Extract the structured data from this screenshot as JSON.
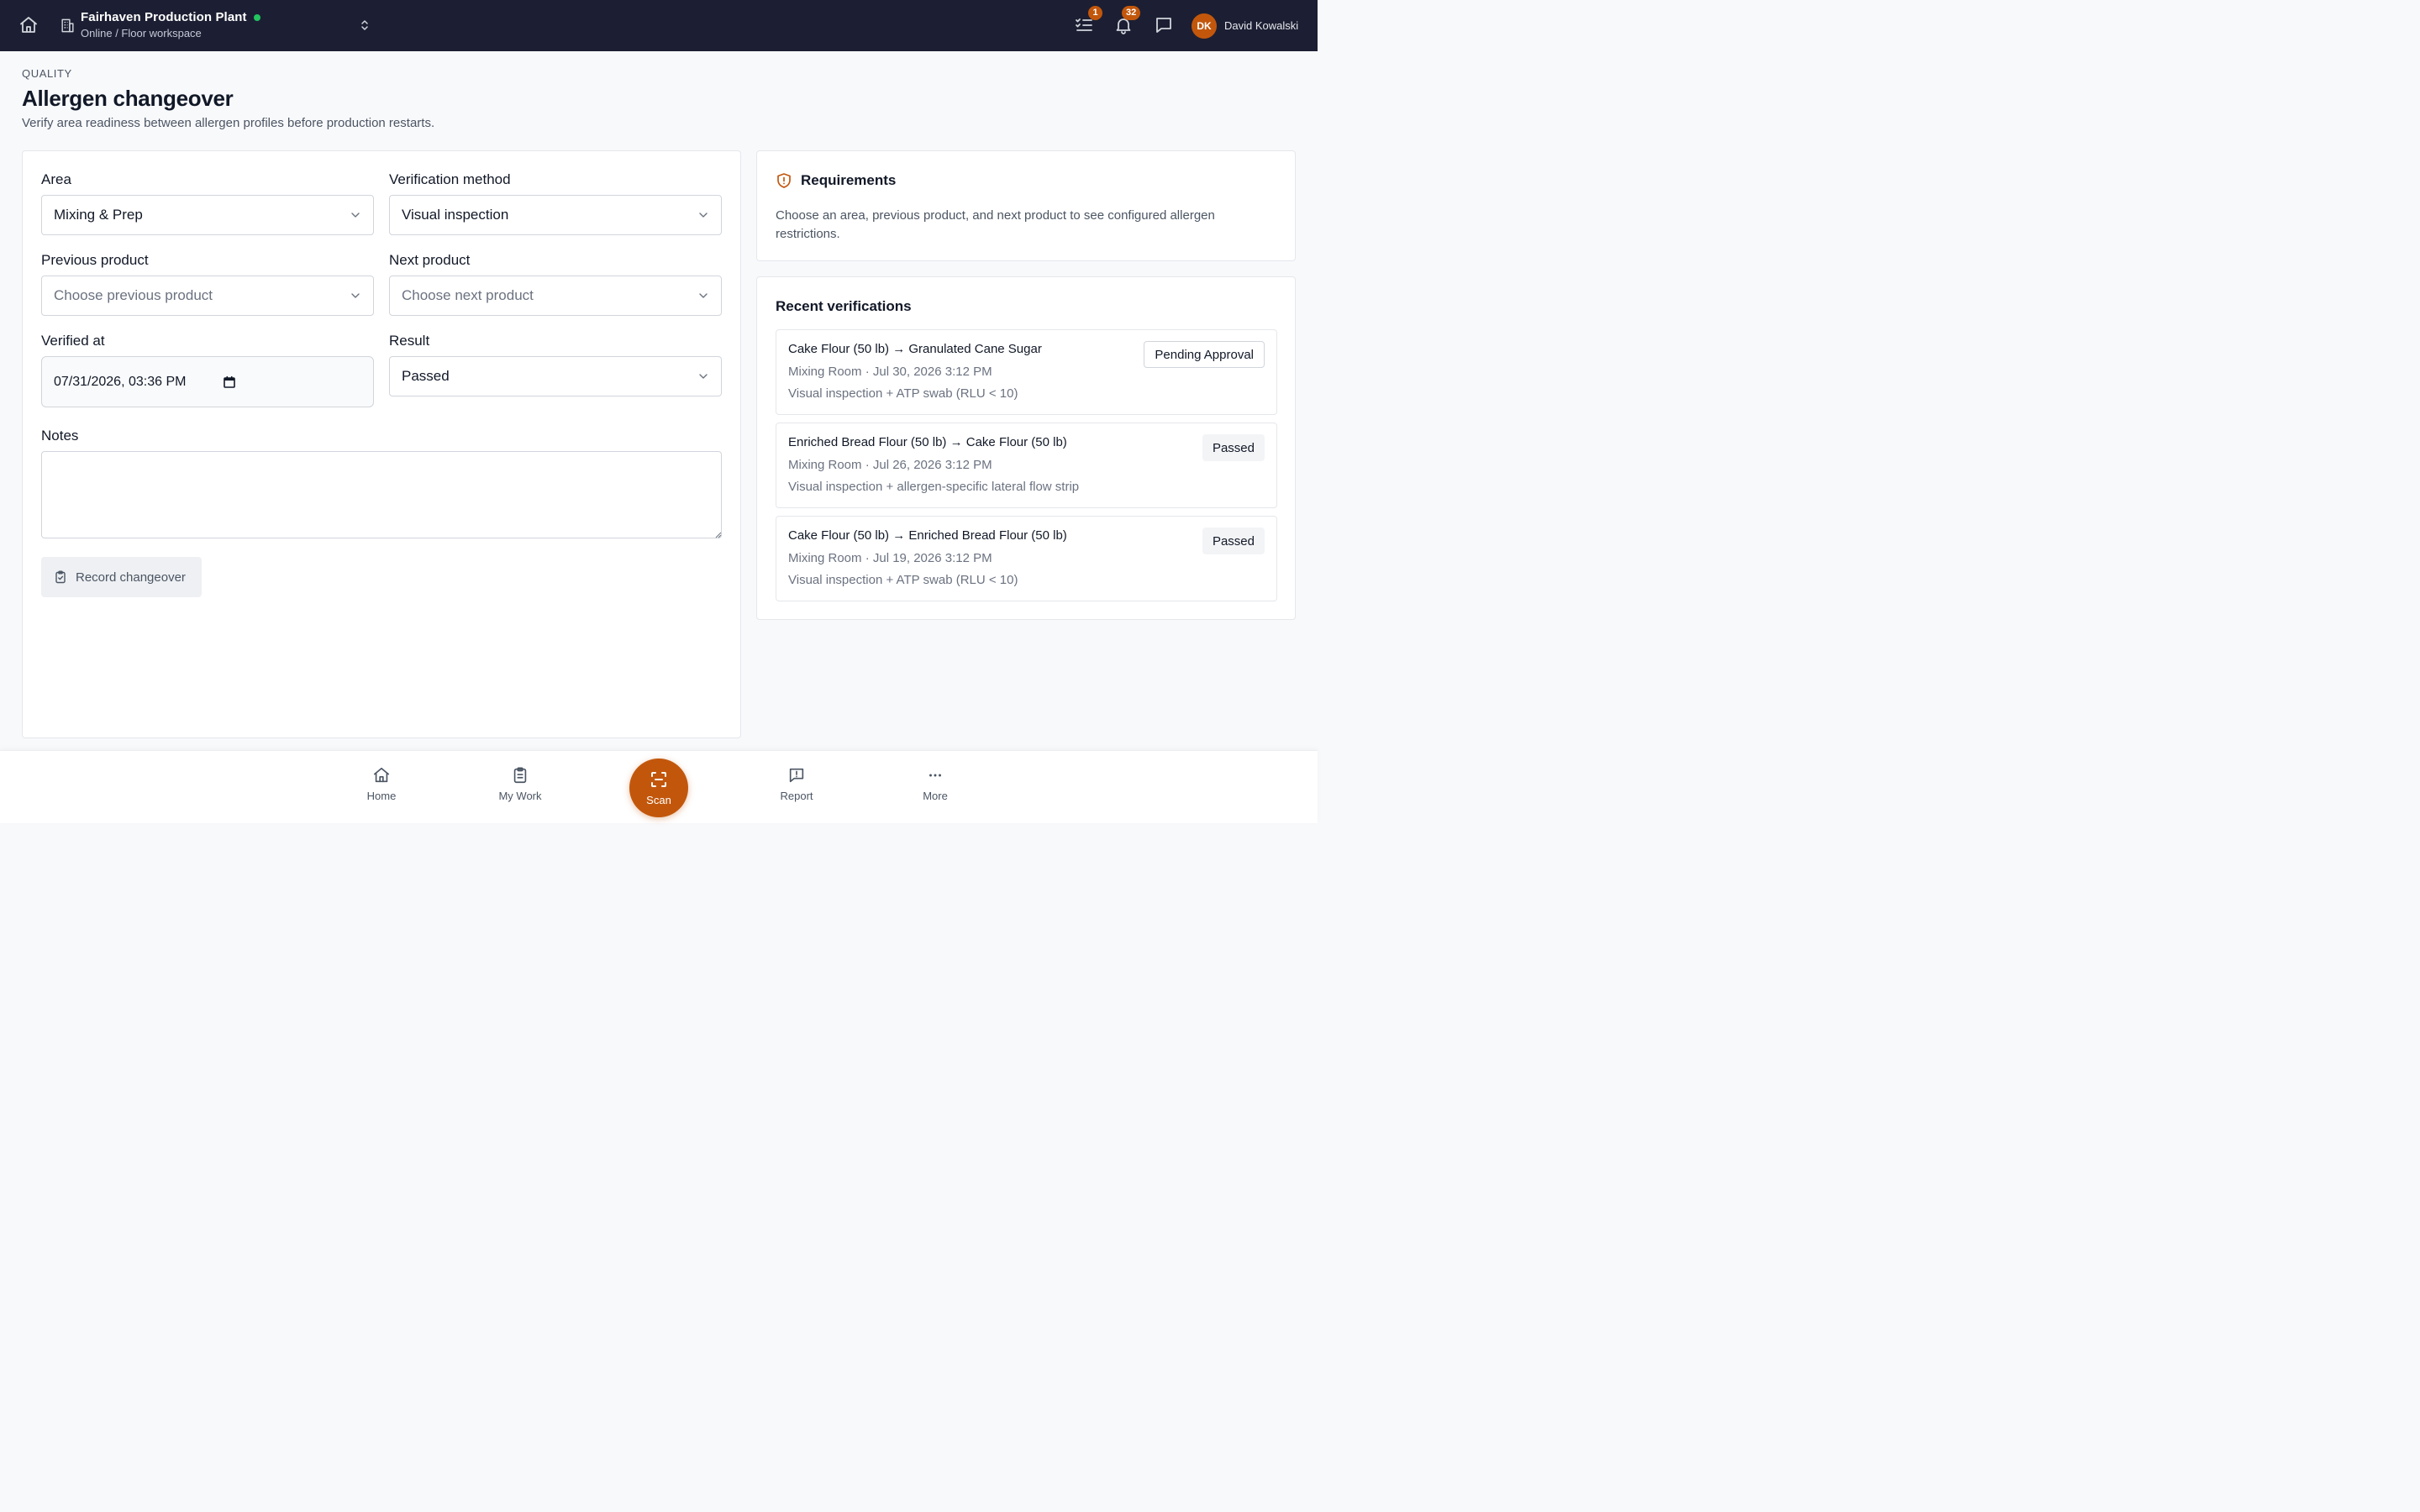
{
  "topbar": {
    "plant_name": "Fairhaven Production Plant",
    "plant_status": "Online / Floor workspace",
    "tasks_badge": "1",
    "notifications_badge": "32",
    "user_initials": "DK",
    "user_name": "David Kowalski",
    "status_color": "#22c55e"
  },
  "header": {
    "eyebrow": "QUALITY",
    "title": "Allergen changeover",
    "subtitle": "Verify area readiness between allergen profiles before production restarts."
  },
  "form": {
    "area_label": "Area",
    "area_value": "Mixing & Prep",
    "method_label": "Verification method",
    "method_value": "Visual inspection",
    "previous_label": "Previous product",
    "previous_placeholder": "Choose previous product",
    "next_label": "Next product",
    "next_placeholder": "Choose next product",
    "verified_label": "Verified at",
    "verified_value": "07/31/2026, 03:36 PM",
    "result_label": "Result",
    "result_value": "Passed",
    "notes_label": "Notes",
    "notes_value": "",
    "submit_label": "Record changeover"
  },
  "requirements": {
    "title": "Requirements",
    "text": "Choose an area, previous product, and next product to see configured allergen restrictions."
  },
  "recent": {
    "title": "Recent verifications",
    "items": [
      {
        "title": "Cake Flour (50 lb) → Granulated Cane Sugar",
        "meta": "Mixing Room · Jul 30, 2026 3:12 PM",
        "method": "Visual inspection + ATP swab (RLU < 10)",
        "status": "Pending Approval"
      },
      {
        "title": "Enriched Bread Flour (50 lb) → Cake Flour (50 lb)",
        "meta": "Mixing Room · Jul 26, 2026 3:12 PM",
        "method": "Visual inspection + allergen-specific lateral flow strip",
        "status": "Passed"
      },
      {
        "title": "Cake Flour (50 lb) → Enriched Bread Flour (50 lb)",
        "meta": "Mixing Room · Jul 19, 2026 3:12 PM",
        "method": "Visual inspection + ATP swab (RLU < 10)",
        "status": "Passed"
      }
    ]
  },
  "nav": {
    "home": "Home",
    "my_work": "My Work",
    "scan": "Scan",
    "report": "Report",
    "more": "More"
  },
  "colors": {
    "topbar": "#1c1f33",
    "accent": "#c2570c"
  }
}
